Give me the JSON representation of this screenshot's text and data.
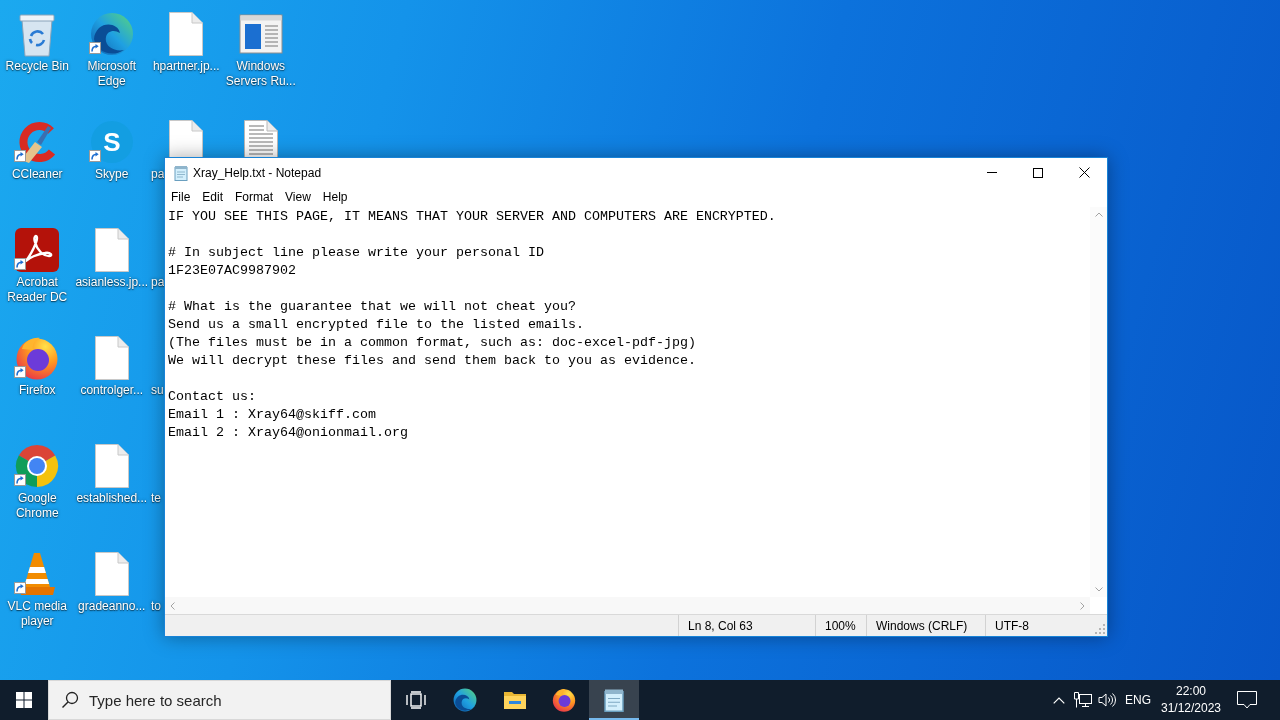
{
  "desktop": {
    "icons": [
      {
        "label": "Recycle Bin",
        "kind": "recycle",
        "shortcut": false,
        "obscured": false
      },
      {
        "label": "CCleaner",
        "kind": "ccleaner",
        "shortcut": true,
        "obscured": false
      },
      {
        "label": "Acrobat Reader DC",
        "kind": "acrobat",
        "shortcut": true,
        "obscured": false
      },
      {
        "label": "Firefox",
        "kind": "firefox",
        "shortcut": true,
        "obscured": false
      },
      {
        "label": "Google Chrome",
        "kind": "chrome",
        "shortcut": true,
        "obscured": false
      },
      {
        "label": "VLC media player",
        "kind": "vlc",
        "shortcut": true,
        "obscured": false
      },
      {
        "label": "Microsoft Edge",
        "kind": "edge",
        "shortcut": true,
        "obscured": false
      },
      {
        "label": "Skype",
        "kind": "skype",
        "letter": "S",
        "shortcut": true,
        "obscured": false
      },
      {
        "label": "asianless.jp...",
        "kind": "document",
        "shortcut": false,
        "obscured": false
      },
      {
        "label": "controlger...",
        "kind": "document",
        "shortcut": false,
        "obscured": false
      },
      {
        "label": "established...",
        "kind": "document",
        "shortcut": false,
        "obscured": false
      },
      {
        "label": "gradeanno...",
        "kind": "document",
        "shortcut": false,
        "obscured": false
      },
      {
        "label": "hpartner.jp...",
        "kind": "document",
        "shortcut": false,
        "obscured": false
      },
      {
        "label": "pa",
        "kind": "document",
        "shortcut": false,
        "obscured": true
      },
      {
        "label": "pa",
        "obscured": true
      },
      {
        "label": "su",
        "obscured": true
      },
      {
        "label": "te",
        "obscured": true
      },
      {
        "label": "to",
        "obscured": true
      },
      {
        "label": "Windows Servers Ru...",
        "kind": "window",
        "shortcut": false,
        "obscured": false
      },
      {
        "kind": "textfile",
        "shortcut": false,
        "obscured": true
      }
    ]
  },
  "notepad": {
    "title": "Xray_Help.txt - Notepad",
    "active": true,
    "menu": [
      "File",
      "Edit",
      "Format",
      "View",
      "Help"
    ],
    "paragraphs": [
      [
        "IF YOU SEE THIS PAGE, IT MEANS THAT YOUR SERVER AND COMPUTERS ARE ENCRYPTED."
      ],
      [
        "# In subject line please write your personal ID",
        "1F23E07AC9987902"
      ],
      [
        "# What is the guarantee that we will not cheat you?",
        "Send us a small encrypted file to the listed emails.",
        "(The files must be in a common format, such as: doc-excel-pdf-jpg)",
        "We will decrypt these files and send them back to you as evidence."
      ],
      [
        "Contact us:",
        "Email 1 : Xray64@skiff.com",
        "Email 2 : Xray64@onionmail.org"
      ]
    ],
    "status": {
      "position": "Ln 8, Col 63",
      "zoom": "100%",
      "line_ending": "Windows (CRLF)",
      "encoding": "UTF-8"
    }
  },
  "taskbar": {
    "search": {
      "placeholder": "Type here to search"
    },
    "apps": [
      {
        "kind": "taskview",
        "selected": false
      },
      {
        "kind": "edge",
        "selected": false
      },
      {
        "kind": "explorer",
        "selected": false
      },
      {
        "kind": "firefox",
        "selected": false
      },
      {
        "kind": "notepad",
        "selected": true
      }
    ],
    "tray": {
      "language": "ENG",
      "time": "22:00",
      "date": "31/12/2023"
    }
  }
}
